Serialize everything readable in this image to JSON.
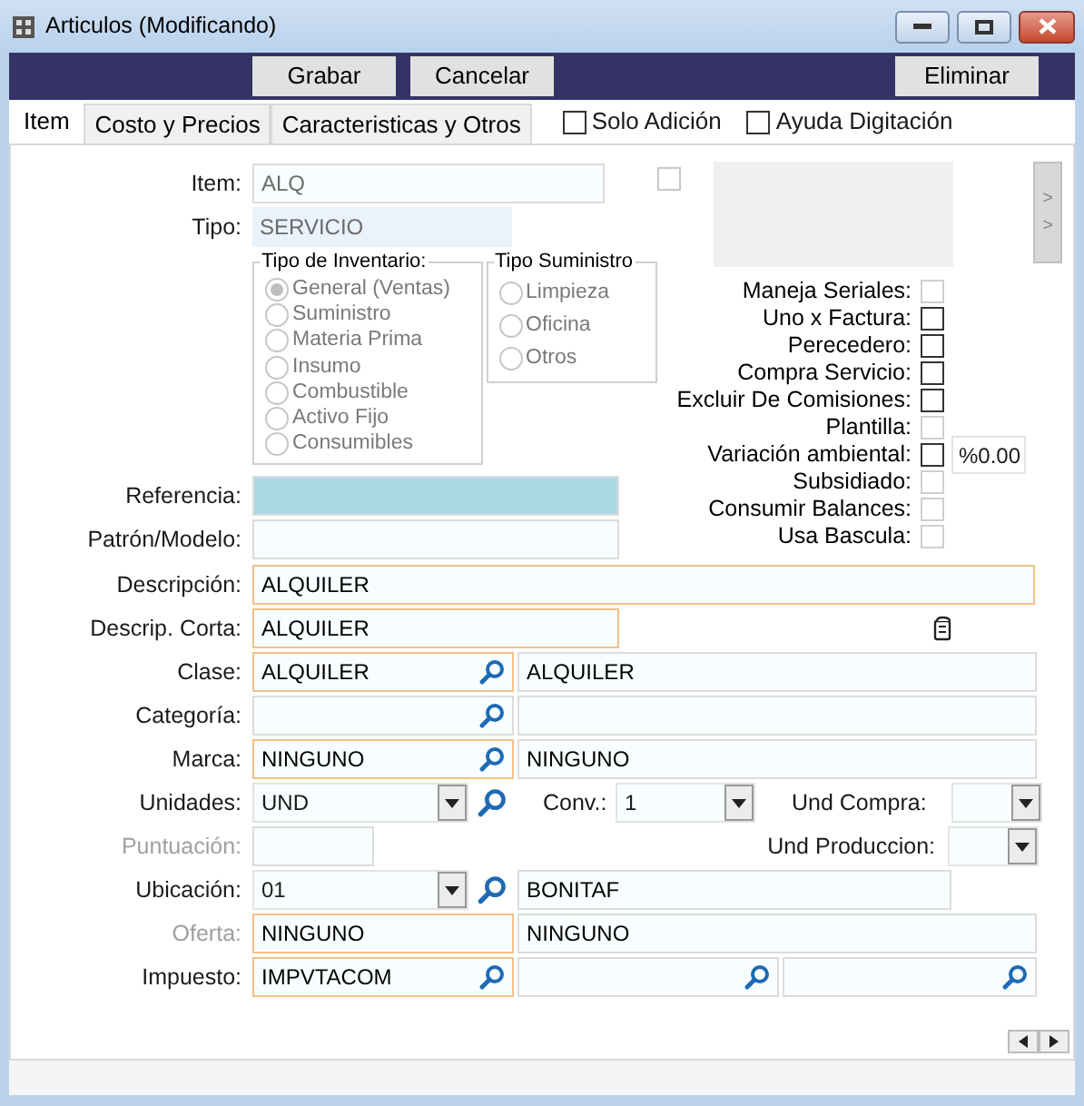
{
  "window": {
    "title": "Articulos (Modificando)"
  },
  "toolbar": {
    "left": [
      {
        "label": "Grabar"
      },
      {
        "label": "Cancelar"
      }
    ],
    "right": [
      {
        "label": "Eliminar"
      }
    ]
  },
  "tabs": [
    {
      "label": "Item",
      "selected": true
    },
    {
      "label": "Costo y Precios",
      "selected": false
    },
    {
      "label": "Caracteristicas y Otros",
      "selected": false
    }
  ],
  "options": [
    {
      "label": "Solo Adición",
      "checked": false
    },
    {
      "label": "Ayuda Digitación",
      "checked": false
    }
  ],
  "item": {
    "label": "Item:",
    "value": "ALQ",
    "flag": {
      "checked": false
    }
  },
  "tipo": {
    "label": "Tipo:",
    "value": "SERVICIO"
  },
  "tipo_inventario": {
    "title": "Tipo de Inventario:",
    "options": [
      {
        "label": "General (Ventas)",
        "selected": true
      },
      {
        "label": "Suministro",
        "selected": false
      },
      {
        "label": "Materia Prima",
        "selected": false
      },
      {
        "label": "Insumo",
        "selected": false
      },
      {
        "label": "Combustible",
        "selected": false
      },
      {
        "label": "Activo Fijo",
        "selected": false
      },
      {
        "label": "Consumibles",
        "selected": false
      }
    ]
  },
  "tipo_suministro": {
    "title": "Tipo Suministro",
    "options": [
      {
        "label": "Limpieza",
        "selected": false
      },
      {
        "label": "Oficina",
        "selected": false
      },
      {
        "label": "Otros",
        "selected": false
      }
    ]
  },
  "side_button": [
    ">",
    ">"
  ],
  "flags": [
    {
      "label": "Maneja Seriales:",
      "checked": false,
      "disabled": true
    },
    {
      "label": "Uno x Factura:",
      "checked": false,
      "disabled": false
    },
    {
      "label": "Perecedero:",
      "checked": false,
      "disabled": false
    },
    {
      "label": "Compra Servicio:",
      "checked": false,
      "disabled": false
    },
    {
      "label": "Excluir De Comisiones:",
      "checked": false,
      "disabled": false
    },
    {
      "label": "Plantilla:",
      "checked": false,
      "disabled": true
    },
    {
      "label": "Variación ambiental:",
      "checked": false,
      "disabled": false,
      "value": "%0.00"
    },
    {
      "label": "Subsidiado:",
      "checked": false,
      "disabled": true
    },
    {
      "label": "Consumir Balances:",
      "checked": false,
      "disabled": true
    },
    {
      "label": "Usa Bascula:",
      "checked": false,
      "disabled": true
    }
  ],
  "referencia": {
    "label": "Referencia:",
    "focused": true
  },
  "patron": {
    "label": "Patrón/Modelo:",
    "focused": false
  },
  "descripcion": {
    "label": "Descripción:",
    "value": "ALQUILER",
    "highlighted": true
  },
  "descrip_corta": {
    "label": "Descrip. Corta:",
    "value": "ALQUILER",
    "highlighted": true
  },
  "clase": {
    "label": "Clase:",
    "code": {
      "value": "ALQUILER",
      "highlighted": true
    },
    "name": "ALQUILER"
  },
  "categoria": {
    "label": "Categoría:",
    "code": {
      "highlighted": false
    }
  },
  "marca": {
    "label": "Marca:",
    "code": {
      "value": "NINGUNO",
      "highlighted": true
    },
    "name": "NINGUNO"
  },
  "unidades": {
    "label": "Unidades:",
    "value": "UND",
    "conv": {
      "label": "Conv.:",
      "value": "1"
    },
    "und_compra": {
      "label": "Und Compra:"
    }
  },
  "puntuacion": {
    "label": "Puntuación:",
    "disabled": true,
    "und_produccion": {
      "label": "Und Produccion:"
    }
  },
  "ubicacion": {
    "label": "Ubicación:",
    "value": "01",
    "name": "BONITAF"
  },
  "oferta": {
    "label": "Oferta:",
    "disabled": true,
    "code": {
      "value": "NINGUNO",
      "highlighted": true
    },
    "name": "NINGUNO"
  },
  "impuesto": {
    "label": "Impuesto:",
    "code": {
      "value": "IMPVTACOM",
      "highlighted": true
    }
  }
}
